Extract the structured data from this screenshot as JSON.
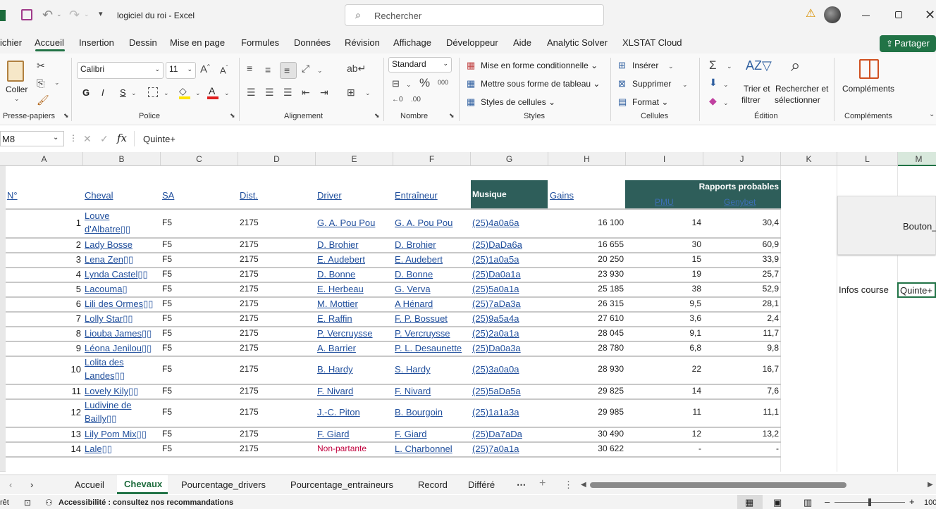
{
  "window": {
    "title": "logiciel du roi  -  Excel",
    "search_placeholder": "Rechercher",
    "share_label": "Partager"
  },
  "menu": [
    "ichier",
    "Accueil",
    "Insertion",
    "Dessin",
    "Mise en page",
    "Formules",
    "Données",
    "Révision",
    "Affichage",
    "Développeur",
    "Aide",
    "Analytic Solver",
    "XLSTAT Cloud"
  ],
  "ribbon": {
    "paste": "Coller",
    "font_name": "Calibri",
    "font_size": "11",
    "number_format": "Standard",
    "cond_format": "Mise en forme conditionnelle",
    "table_format": "Mettre sous forme de tableau",
    "cell_styles": "Styles de cellules",
    "insert": "Insérer",
    "delete": "Supprimer",
    "format": "Format",
    "sort_filter_1": "Trier et",
    "sort_filter_2": "filtrer",
    "find_1": "Rechercher et",
    "find_2": "sélectionner",
    "addins": "Compléments",
    "bold": "G",
    "italic": "I",
    "underline": "S",
    "groups": {
      "clipboard": "Presse-papiers",
      "font": "Police",
      "alignment": "Alignement",
      "number": "Nombre",
      "styles": "Styles",
      "cells": "Cellules",
      "editing": "Édition",
      "addins": "Compléments"
    }
  },
  "formula_bar": {
    "name_box": "M8",
    "fx": "fx",
    "value": "Quinte+"
  },
  "columns": [
    "A",
    "B",
    "C",
    "D",
    "E",
    "F",
    "G",
    "H",
    "I",
    "J",
    "K",
    "L",
    "M"
  ],
  "headers": {
    "num": "N°",
    "cheval": "Cheval",
    "sa": "SA",
    "dist": "Dist.",
    "driver": "Driver",
    "entraineur": "Entraîneur",
    "musique": "Musique",
    "gains": "Gains",
    "rapports": "Rapports probables",
    "pmu": "PMU",
    "genybet": "Genybet"
  },
  "rows": [
    {
      "n": "1",
      "cheval_1": "Louve",
      "cheval_2": "d'Albatre▯▯",
      "sa": "F5",
      "dist": "2175",
      "driver": "G. A. Pou Pou",
      "ent": "G. A. Pou Pou",
      "mus": "(25)4a0a6a",
      "gains": "16 100",
      "pmu": "14",
      "geny": "30,4"
    },
    {
      "n": "2",
      "cheval_1": "Lady Bosse",
      "sa": "F5",
      "dist": "2175",
      "driver": "D. Brohier",
      "ent": "D. Brohier",
      "mus": "(25)DaDa6a",
      "gains": "16 655",
      "pmu": "30",
      "geny": "60,9"
    },
    {
      "n": "3",
      "cheval_1": "Lena Zen▯▯",
      "sa": "F5",
      "dist": "2175",
      "driver": "E. Audebert",
      "ent": "E. Audebert",
      "mus": "(25)1a0a5a",
      "gains": "20 250",
      "pmu": "15",
      "geny": "33,9"
    },
    {
      "n": "4",
      "cheval_1": "Lynda Castel▯▯",
      "sa": "F5",
      "dist": "2175",
      "driver": "D. Bonne",
      "ent": "D. Bonne",
      "mus": "(25)Da0a1a",
      "gains": "23 930",
      "pmu": "19",
      "geny": "25,7"
    },
    {
      "n": "5",
      "cheval_1": "Lacouma▯",
      "sa": "F5",
      "dist": "2175",
      "driver": "E. Herbeau",
      "ent": "G. Verva",
      "mus": "(25)5a0a1a",
      "gains": "25 185",
      "pmu": "38",
      "geny": "52,9"
    },
    {
      "n": "6",
      "cheval_1": "Lili des Ormes▯▯",
      "sa": "F5",
      "dist": "2175",
      "driver": "M. Mottier",
      "ent": "A Hénard",
      "mus": "(25)7aDa3a",
      "gains": "26 315",
      "pmu": "9,5",
      "geny": "28,1"
    },
    {
      "n": "7",
      "cheval_1": "Lolly Star▯▯",
      "sa": "F5",
      "dist": "2175",
      "driver": "E. Raffin",
      "ent": "F. P. Bossuet",
      "mus": "(25)9a5a4a",
      "gains": "27 610",
      "pmu": "3,6",
      "geny": "2,4"
    },
    {
      "n": "8",
      "cheval_1": "Liouba James▯▯",
      "sa": "F5",
      "dist": "2175",
      "driver": "P. Vercruysse",
      "ent": "P. Vercruysse",
      "mus": "(25)2a0a1a",
      "gains": "28 045",
      "pmu": "9,1",
      "geny": "11,7"
    },
    {
      "n": "9",
      "cheval_1": "Léona Jenilou▯▯",
      "sa": "F5",
      "dist": "2175",
      "driver": "A. Barrier",
      "ent": "P. L. Desaunette",
      "mus": "(25)Da0a3a",
      "gains": "28 780",
      "pmu": "6,8",
      "geny": "9,8"
    },
    {
      "n": "10",
      "cheval_1": "Lolita des",
      "cheval_2": "Landes▯▯",
      "sa": "F5",
      "dist": "2175",
      "driver": "B. Hardy",
      "ent": "S. Hardy",
      "mus": "(25)3a0a0a",
      "gains": "28 930",
      "pmu": "22",
      "geny": "16,7"
    },
    {
      "n": "11",
      "cheval_1": "Lovely Kily▯▯",
      "sa": "F5",
      "dist": "2175",
      "driver": "F. Nivard",
      "ent": "F. Nivard",
      "mus": "(25)5aDa5a",
      "gains": "29 825",
      "pmu": "14",
      "geny": "7,6"
    },
    {
      "n": "12",
      "cheval_1": "Ludivine de",
      "cheval_2": "Bailly▯▯",
      "sa": "F5",
      "dist": "2175",
      "driver": "J.-C. Piton",
      "ent": "B. Bourgoin",
      "mus": "(25)1a1a3a",
      "gains": "29 985",
      "pmu": "11",
      "geny": "11,1"
    },
    {
      "n": "13",
      "cheval_1": "Lily Pom Mix▯▯",
      "sa": "F5",
      "dist": "2175",
      "driver": "F. Giard",
      "ent": "F. Giard",
      "mus": "(25)Da7aDa",
      "gains": "30 490",
      "pmu": "12",
      "geny": "13,2"
    },
    {
      "n": "14",
      "cheval_1": "Lale▯▯",
      "sa": "F5",
      "dist": "2175",
      "driver": "Non-partante",
      "ent": "L. Charbonnel",
      "mus": "(25)7a0a1a",
      "gains": "30 622",
      "pmu": "-",
      "geny": "-"
    }
  ],
  "side": {
    "button": "Bouton_",
    "infos_label": "Infos course",
    "infos_value": "Quinte+"
  },
  "sheet_tabs": [
    "Accueil",
    "Chevaux",
    "Pourcentage_drivers",
    "Pourcentage_entraineurs",
    "Record",
    "Différé"
  ],
  "active_sheet": "Chevaux",
  "status": {
    "left": "rêt",
    "accessibility": "Accessibilité : consultez nos recommandations",
    "zoom": "100"
  },
  "colors": {
    "teal": "#2e5e5a",
    "excel_green": "#217346",
    "link": "#1f4e9c",
    "nonpartante": "#c0003c"
  }
}
